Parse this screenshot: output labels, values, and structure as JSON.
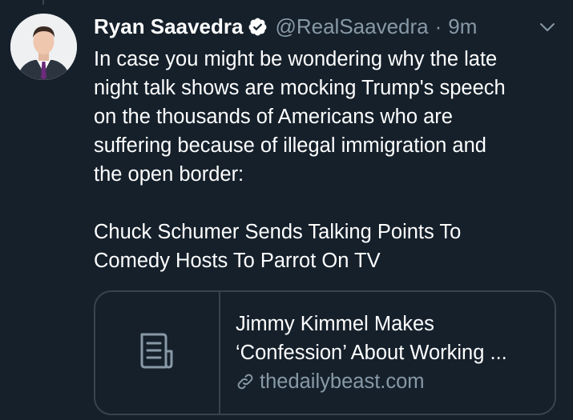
{
  "tweet": {
    "author": {
      "display_name": "Ryan Saavedra",
      "verified_icon": "verified-badge-icon",
      "handle": "@RealSaavedra",
      "separator": "·",
      "time": "9m"
    },
    "text": "In case you might be wondering why the late\nnight talk shows are mocking Trump's speech\non the thousands of Americans who are\nsuffering because of illegal immigration and\nthe open border:\n\nChuck Schumer Sends Talking Points To\nComedy Hosts To Parrot On TV",
    "card": {
      "thumbnail_icon": "document-icon",
      "title_line1": "Jimmy Kimmel Makes",
      "title_line2": "‘Confession’ About Working ...",
      "link_icon": "link-icon",
      "domain": "thedailybeast.com"
    }
  },
  "colors": {
    "background": "#15202b",
    "text_primary": "#ffffff",
    "text_secondary": "#8899a6",
    "border": "#38444d"
  }
}
